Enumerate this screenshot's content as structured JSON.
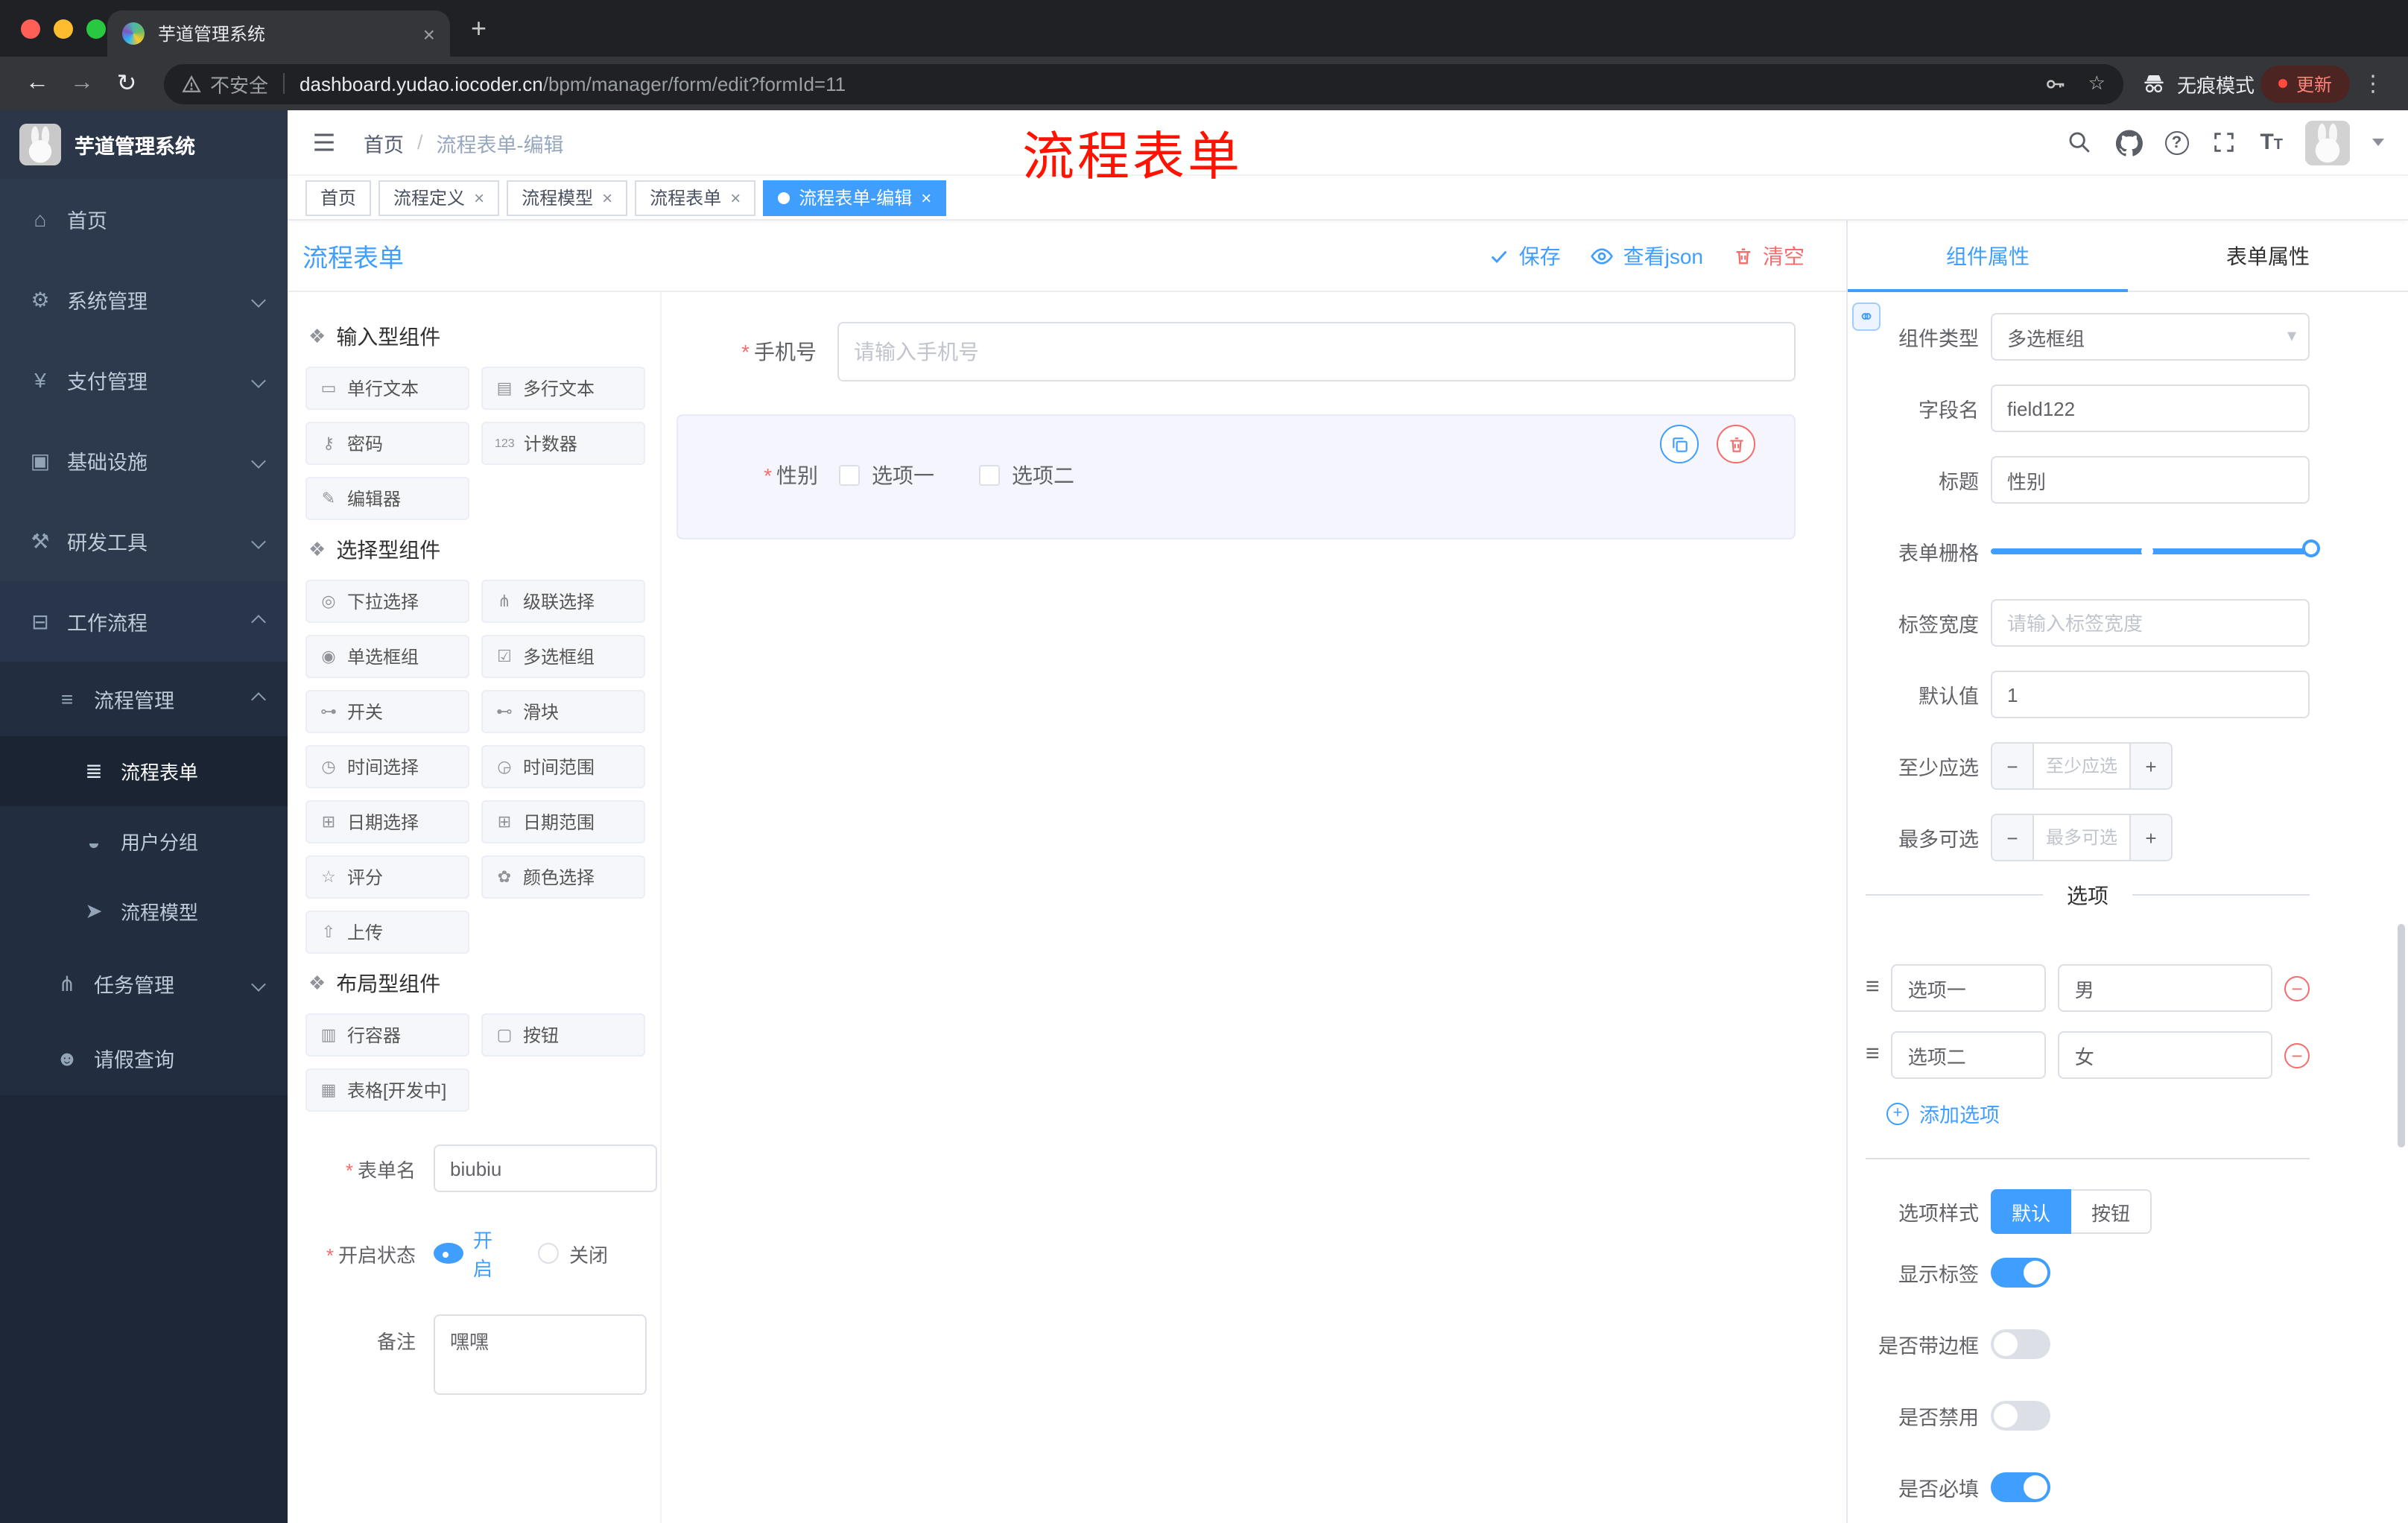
{
  "colors": {
    "primary": "#409eff",
    "danger": "#f56c6c",
    "sidebar_bg": "#2d3a4d"
  },
  "icons": {
    "asterisk": "*",
    "close": "×",
    "new_tab": "+",
    "back": "←",
    "forward": "→",
    "reload": "↻",
    "bookmark_star": "☆",
    "kebab": "⋮",
    "minus": "−",
    "plus": "+",
    "caret_down": "▾",
    "handle": "≡",
    "help": "?",
    "breadcrumb_separator": "/",
    "font_size_big": "T",
    "font_size_small": "T",
    "link": "⚭"
  },
  "browser": {
    "tab_title": "芋道管理系统",
    "security_label": "不安全",
    "url_host": "dashboard.yudao.iocoder.cn",
    "url_path": "/bpm/manager/form/edit?formId=11",
    "incognito_label": "无痕模式",
    "update_label": "更新"
  },
  "annotation": "流程表单",
  "sidebar": {
    "logo_title": "芋道管理系统",
    "menu": [
      {
        "label": "首页",
        "icon": "⌂"
      },
      {
        "label": "系统管理",
        "icon": "⚙"
      },
      {
        "label": "支付管理",
        "icon": "¥"
      },
      {
        "label": "基础设施",
        "icon": "▣"
      },
      {
        "label": "研发工具",
        "icon": "⚒"
      },
      {
        "label": "工作流程",
        "icon": "⊟"
      },
      {
        "label": "流程管理",
        "icon": "≡"
      },
      {
        "label": "流程表单",
        "icon": "≣"
      },
      {
        "label": "用户分组",
        "icon": "◒"
      },
      {
        "label": "流程模型",
        "icon": "➤"
      },
      {
        "label": "任务管理",
        "icon": "⋔"
      },
      {
        "label": "请假查询",
        "icon": "☻"
      }
    ]
  },
  "header": {
    "breadcrumb": [
      "首页",
      "流程表单-编辑"
    ]
  },
  "tags": [
    {
      "label": "首页"
    },
    {
      "label": "流程定义"
    },
    {
      "label": "流程模型"
    },
    {
      "label": "流程表单"
    },
    {
      "label": "流程表单-编辑"
    }
  ],
  "designer": {
    "title": "流程表单",
    "actions": {
      "save": "保存",
      "view_json": "查看json",
      "clear": "清空"
    },
    "palette": {
      "sections": [
        {
          "title": "输入型组件",
          "items": [
            {
              "icon": "▭",
              "label": "单行文本"
            },
            {
              "icon": "▤",
              "label": "多行文本"
            },
            {
              "icon": "⚷",
              "label": "密码"
            },
            {
              "icon": "123",
              "label": "计数器"
            },
            {
              "icon": "✎",
              "label": "编辑器"
            }
          ]
        },
        {
          "title": "选择型组件",
          "items": [
            {
              "icon": "◎",
              "label": "下拉选择"
            },
            {
              "icon": "⋔",
              "label": "级联选择"
            },
            {
              "icon": "◉",
              "label": "单选框组"
            },
            {
              "icon": "☑",
              "label": "多选框组"
            },
            {
              "icon": "⊶",
              "label": "开关"
            },
            {
              "icon": "⊷",
              "label": "滑块"
            },
            {
              "icon": "◷",
              "label": "时间选择"
            },
            {
              "icon": "◶",
              "label": "时间范围"
            },
            {
              "icon": "⊞",
              "label": "日期选择"
            },
            {
              "icon": "⊞",
              "label": "日期范围"
            },
            {
              "icon": "☆",
              "label": "评分"
            },
            {
              "icon": "✿",
              "label": "颜色选择"
            },
            {
              "icon": "⇧",
              "label": "上传"
            }
          ]
        },
        {
          "title": "布局型组件",
          "items": [
            {
              "icon": "▥",
              "label": "行容器"
            },
            {
              "icon": "▢",
              "label": "按钮"
            },
            {
              "icon": "▦",
              "label": "表格[开发中]"
            }
          ]
        }
      ]
    },
    "meta": {
      "name": {
        "label": "表单名",
        "value": "biubiu"
      },
      "status": {
        "label": "开启状态",
        "options": [
          {
            "label": "开启"
          },
          {
            "label": "关闭"
          }
        ],
        "selected": "开启"
      },
      "remark": {
        "label": "备注",
        "value": "嘿嘿"
      }
    },
    "canvas": {
      "phone": {
        "label": "手机号",
        "placeholder": "请输入手机号"
      },
      "gender": {
        "label": "性别",
        "options": [
          "选项一",
          "选项二"
        ]
      }
    }
  },
  "props": {
    "tabs": [
      "组件属性",
      "表单属性"
    ],
    "active_tab": "组件属性",
    "component_type": {
      "label": "组件类型",
      "value": "多选框组"
    },
    "field_name": {
      "label": "字段名",
      "value": "field122"
    },
    "title": {
      "label": "标题",
      "value": "性别"
    },
    "grid": {
      "label": "表单栅格"
    },
    "label_width": {
      "label": "标签宽度",
      "placeholder": "请输入标签宽度"
    },
    "default_value": {
      "label": "默认值",
      "value": "1"
    },
    "min_select": {
      "label": "至少应选",
      "placeholder": "至少应选"
    },
    "max_select": {
      "label": "最多可选",
      "placeholder": "最多可选"
    },
    "options_title": "选项",
    "options": [
      {
        "name": "选项一",
        "value": "男"
      },
      {
        "name": "选项二",
        "value": "女"
      }
    ],
    "add_option": "添加选项",
    "option_style": {
      "label": "选项样式",
      "options": [
        "默认",
        "按钮"
      ],
      "selected": "默认"
    },
    "show_label": {
      "label": "显示标签",
      "on": true
    },
    "border": {
      "label": "是否带边框",
      "on": false
    },
    "disabled": {
      "label": "是否禁用",
      "on": false
    },
    "required": {
      "label": "是否必填",
      "on": true
    }
  }
}
